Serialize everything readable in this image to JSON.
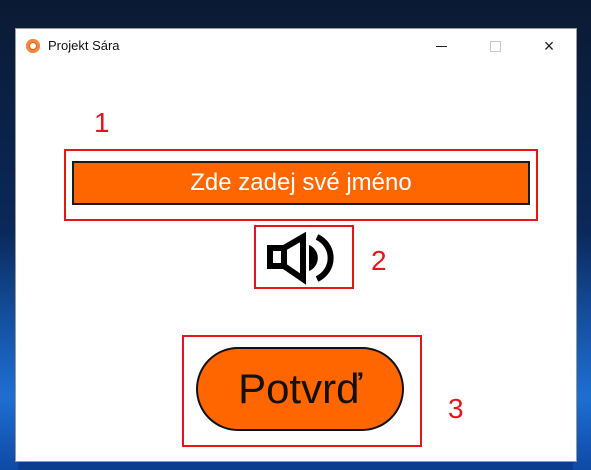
{
  "window": {
    "title": "Projekt Sára",
    "controls": {
      "minimize": "minimize",
      "maximize": "maximize",
      "close": "×"
    }
  },
  "name_field": {
    "placeholder": "Zde zadej své jméno"
  },
  "speaker": {
    "icon": "speaker-icon"
  },
  "confirm_button": {
    "label": "Potvrď"
  },
  "annotations": {
    "one": "1",
    "two": "2",
    "three": "3"
  },
  "colors": {
    "accent": "#ff6600",
    "annotation": "#e8141a"
  }
}
